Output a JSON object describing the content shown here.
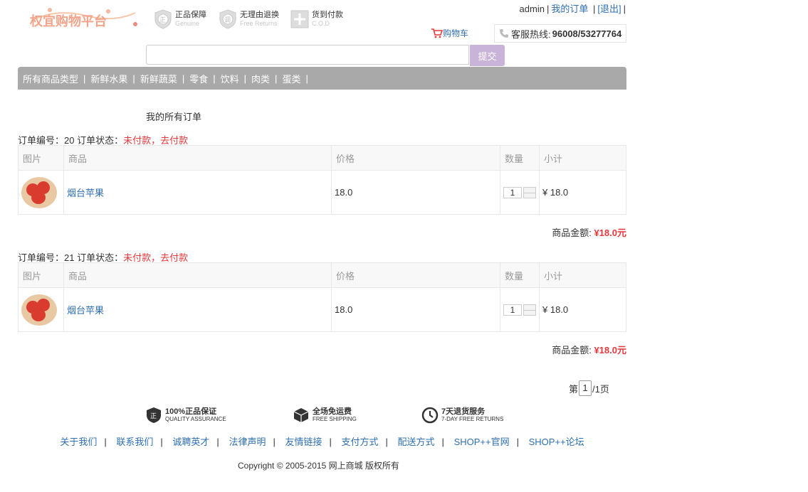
{
  "header": {
    "logo_text": "权宜购物平台",
    "badges": [
      {
        "cn": "正品保障",
        "en": "Genuine",
        "icon": "genuine-icon"
      },
      {
        "cn": "无理由退换",
        "en": "Free Returns",
        "icon": "returns-icon"
      },
      {
        "cn": "货到付款",
        "en": "C.O.D",
        "icon": "cod-icon"
      }
    ],
    "user": "admin",
    "my_orders": "我的订单",
    "logout": "[退出]",
    "cart": "购物车",
    "hotline_label": "客服热线:",
    "hotline_number": "96008/53277764",
    "search_placeholder": "",
    "submit": "提交"
  },
  "nav": {
    "items": [
      "所有商品类型",
      "新鲜水果",
      "新鲜蔬菜",
      "零食",
      "饮料",
      "肉类",
      "蛋类"
    ]
  },
  "main": {
    "title": "我的所有订单",
    "columns": [
      "图片",
      "商品",
      "价格",
      "数量",
      "小计"
    ],
    "total_label": "商品金额:",
    "orders": [
      {
        "id_label": "订单编号：20 订单状态：",
        "status": "未付款，去付款",
        "item": {
          "name": "烟台苹果",
          "price": "18.0",
          "qty": "1",
          "subtotal": "¥ 18.0"
        },
        "total": "¥18.0元"
      },
      {
        "id_label": "订单编号：21 订单状态：",
        "status": "未付款，去付款",
        "item": {
          "name": "烟台苹果",
          "price": "18.0",
          "qty": "1",
          "subtotal": "¥ 18.0"
        },
        "total": "¥18.0元"
      }
    ],
    "pager": {
      "prefix": "第",
      "current": "1",
      "suffix": "/1页"
    }
  },
  "footer": {
    "services": [
      {
        "cn": "100%正品保证",
        "en": "QUALITY ASSURANCE",
        "icon": "quality-shield-icon"
      },
      {
        "cn": "全场免运费",
        "en": "FREE SHIPPING",
        "icon": "shipping-box-icon"
      },
      {
        "cn": "7天退货服务",
        "en": "7-DAY FREE RETURNS",
        "icon": "clock-icon"
      }
    ],
    "links": [
      "关于我们",
      "联系我们",
      "诚聘英才",
      "法律声明",
      "友情链接",
      "支付方式",
      "配送方式",
      "SHOP++官网",
      "SHOP++论坛"
    ],
    "copyright": "Copyright © 2005-2015 网上商城 版权所有"
  },
  "colors": {
    "accent_red": "#e4393c",
    "link_blue": "#2f6fb0",
    "nav_gray": "#a9a9a9",
    "submit_purple": "#c9b3d8"
  }
}
